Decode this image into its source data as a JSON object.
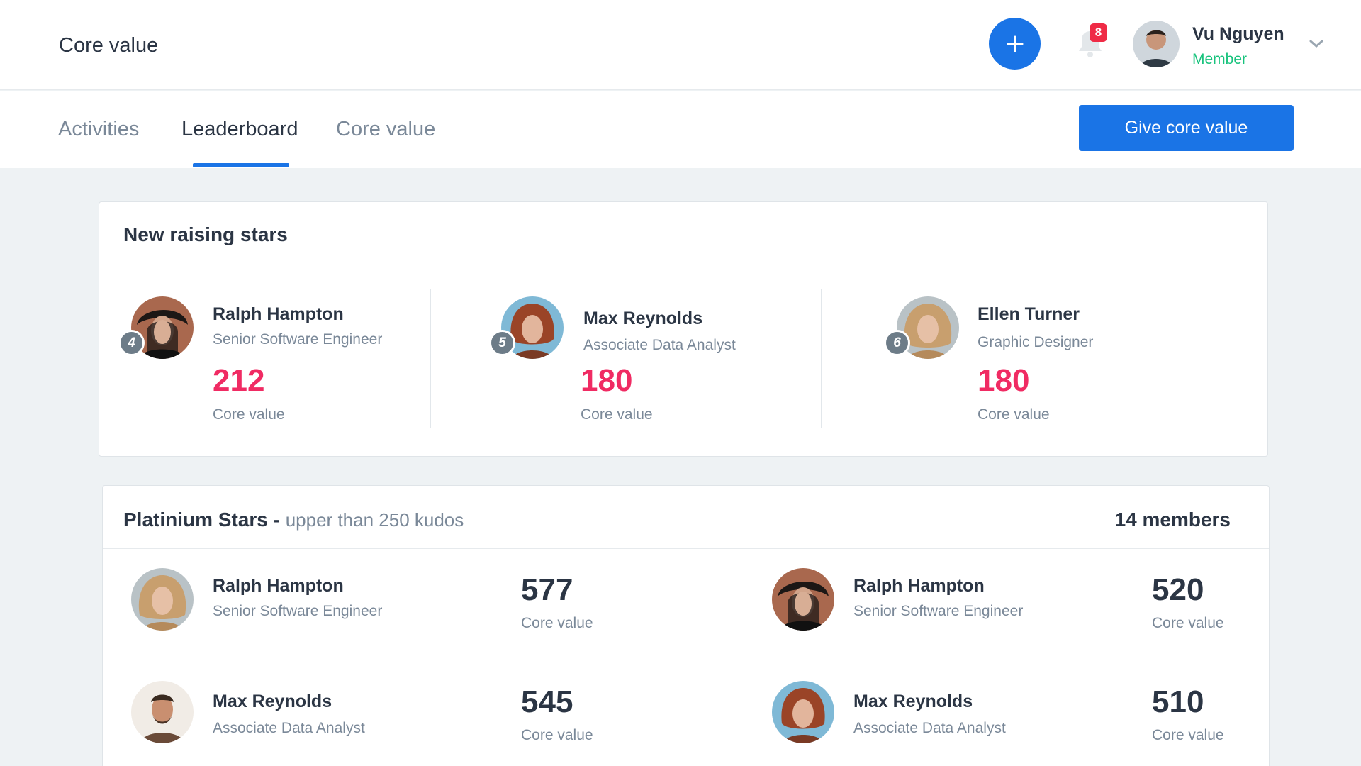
{
  "header": {
    "app_title": "Core value",
    "notification_count": "8",
    "user": {
      "name": "Vu Nguyen",
      "role": "Member"
    }
  },
  "tabs": [
    {
      "label": "Activities"
    },
    {
      "label": "Leaderboard"
    },
    {
      "label": "Core value"
    }
  ],
  "actions": {
    "give_label": "Give core value"
  },
  "rising": {
    "title": "New raising stars",
    "people": [
      {
        "rank": "4",
        "name": "Ralph Hampton",
        "role": "Senior Software Engineer",
        "score": "212",
        "score_label": "Core value"
      },
      {
        "rank": "5",
        "name": "Max Reynolds",
        "role": "Associate Data Analyst",
        "score": "180",
        "score_label": "Core value"
      },
      {
        "rank": "6",
        "name": "Ellen Turner",
        "role": "Graphic Designer",
        "score": "180",
        "score_label": "Core value"
      }
    ]
  },
  "platinum": {
    "title": "Platinium Stars -",
    "subtitle": "upper than 250 kudos",
    "member_count": "14 members",
    "people": [
      {
        "name": "Ralph Hampton",
        "role": "Senior Software Engineer",
        "score": "577",
        "score_label": "Core value"
      },
      {
        "name": "Max Reynolds",
        "role": "Associate Data Analyst",
        "score": "545",
        "score_label": "Core value"
      },
      {
        "name": "Ralph Hampton",
        "role": "Senior Software Engineer",
        "score": "520",
        "score_label": "Core value"
      },
      {
        "name": "Max Reynolds",
        "role": "Associate Data Analyst",
        "score": "510",
        "score_label": "Core value"
      }
    ]
  },
  "colors": {
    "accent": "#1a74e6",
    "score_highlight": "#f02b63",
    "member_role": "#18c37d",
    "badge": "#ef2b46"
  }
}
